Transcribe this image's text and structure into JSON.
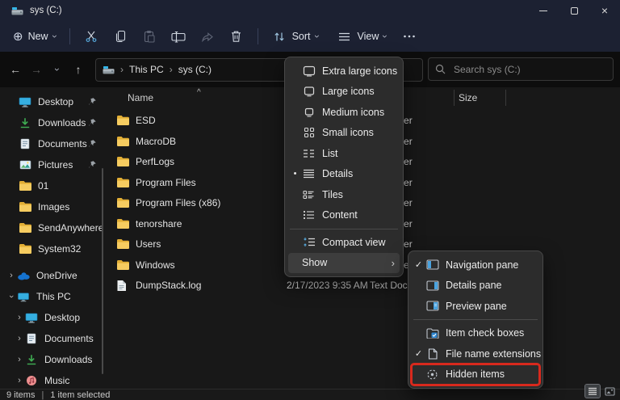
{
  "colors": {
    "accent_blue": "#4aa3e0",
    "folder_yellow": "#f5c54a",
    "highlight_red": "#d8291d",
    "titlebar_bg": "#1c2132"
  },
  "titlebar": {
    "title": "sys (C:)",
    "app_icon": "drive-icon",
    "controls": [
      "minimize",
      "maximize",
      "close"
    ]
  },
  "toolbar": {
    "new_label": "New",
    "buttons": [
      {
        "name": "cut",
        "icon": "cut-icon",
        "enabled": true
      },
      {
        "name": "copy",
        "icon": "copy-icon",
        "enabled": true
      },
      {
        "name": "paste",
        "icon": "paste-icon",
        "enabled": false
      },
      {
        "name": "rename",
        "icon": "rename-icon",
        "enabled": true
      },
      {
        "name": "share",
        "icon": "share-icon",
        "enabled": false
      },
      {
        "name": "delete",
        "icon": "delete-icon",
        "enabled": true
      }
    ],
    "sort_label": "Sort",
    "view_label": "View",
    "more_icon": "more-options-icon"
  },
  "addressbar": {
    "nav": [
      "back",
      "forward",
      "recent-dropdown",
      "up"
    ],
    "breadcrumb": {
      "root_icon": "drive-icon",
      "segments": [
        "This PC",
        "sys (C:)"
      ]
    },
    "refresh_icon": "refresh-icon",
    "search_placeholder": "Search sys (C:)"
  },
  "sidebar": {
    "quick_access": [
      {
        "label": "Desktop",
        "icon": "desktop",
        "pinned": true
      },
      {
        "label": "Downloads",
        "icon": "downloads",
        "pinned": true
      },
      {
        "label": "Documents",
        "icon": "documents",
        "pinned": true
      },
      {
        "label": "Pictures",
        "icon": "pictures",
        "pinned": true
      },
      {
        "label": "01",
        "icon": "folder",
        "pinned": false
      },
      {
        "label": "Images",
        "icon": "folder",
        "pinned": false
      },
      {
        "label": "SendAnywhere",
        "icon": "folder",
        "pinned": false
      },
      {
        "label": "System32",
        "icon": "folder",
        "pinned": false
      }
    ],
    "tree": [
      {
        "label": "OneDrive",
        "icon": "onedrive",
        "expanded": false,
        "indent": 0
      },
      {
        "label": "This PC",
        "icon": "thispc",
        "expanded": true,
        "indent": 0
      },
      {
        "label": "Desktop",
        "icon": "desktop",
        "expanded": false,
        "indent": 1
      },
      {
        "label": "Documents",
        "icon": "documents",
        "expanded": false,
        "indent": 1
      },
      {
        "label": "Downloads",
        "icon": "downloads",
        "expanded": false,
        "indent": 1
      },
      {
        "label": "Music",
        "icon": "music",
        "expanded": false,
        "indent": 1
      }
    ]
  },
  "filelist": {
    "columns": {
      "name": "Name",
      "size": "Size",
      "sort_indicator": "^"
    },
    "rows": [
      {
        "name": "ESD",
        "icon": "folder",
        "date_modified": "",
        "type": "File folder"
      },
      {
        "name": "MacroDB",
        "icon": "folder",
        "date_modified": "",
        "type": "File folder"
      },
      {
        "name": "PerfLogs",
        "icon": "folder",
        "date_modified": "",
        "type": "File folder"
      },
      {
        "name": "Program Files",
        "icon": "folder",
        "date_modified": "",
        "type": "File folder"
      },
      {
        "name": "Program Files (x86)",
        "icon": "folder",
        "date_modified": "",
        "type": "File folder"
      },
      {
        "name": "tenorshare",
        "icon": "folder",
        "date_modified": "",
        "type": "File folder"
      },
      {
        "name": "Users",
        "icon": "folder",
        "date_modified": "",
        "type": "File folder"
      },
      {
        "name": "Windows",
        "icon": "folder",
        "date_modified": "",
        "type": "File folder"
      },
      {
        "name": "DumpStack.log",
        "icon": "file",
        "date_modified": "2/17/2023 9:35 AM",
        "type": "Text Document"
      }
    ]
  },
  "view_menu": {
    "items": [
      {
        "label": "Extra large icons",
        "icon": "xl-icons"
      },
      {
        "label": "Large icons",
        "icon": "l-icons"
      },
      {
        "label": "Medium icons",
        "icon": "m-icons"
      },
      {
        "label": "Small icons",
        "icon": "s-icons"
      },
      {
        "label": "List",
        "icon": "list-view"
      },
      {
        "label": "Details",
        "icon": "details-view",
        "selected": true
      },
      {
        "label": "Tiles",
        "icon": "tiles-view"
      },
      {
        "label": "Content",
        "icon": "content-view"
      },
      {
        "separator": true
      },
      {
        "label": "Compact view",
        "icon": "compact-view"
      },
      {
        "label": "Show",
        "submenu": true,
        "hover": true
      }
    ]
  },
  "show_submenu": {
    "items": [
      {
        "label": "Navigation pane",
        "icon": "nav-pane",
        "checked": true
      },
      {
        "label": "Details pane",
        "icon": "details-pane",
        "checked": false
      },
      {
        "label": "Preview pane",
        "icon": "preview-pane",
        "checked": false
      },
      {
        "separator": true
      },
      {
        "label": "Item check boxes",
        "icon": "item-checkboxes",
        "checked": false
      },
      {
        "label": "File name extensions",
        "icon": "file-extensions",
        "checked": true
      },
      {
        "label": "Hidden items",
        "icon": "hidden-items",
        "checked": false,
        "highlighted": true
      }
    ]
  },
  "statusbar": {
    "count": "9 items",
    "selected": "1 item selected",
    "view_toggles": [
      "details-view-toggle",
      "thumbnail-view-toggle"
    ]
  }
}
